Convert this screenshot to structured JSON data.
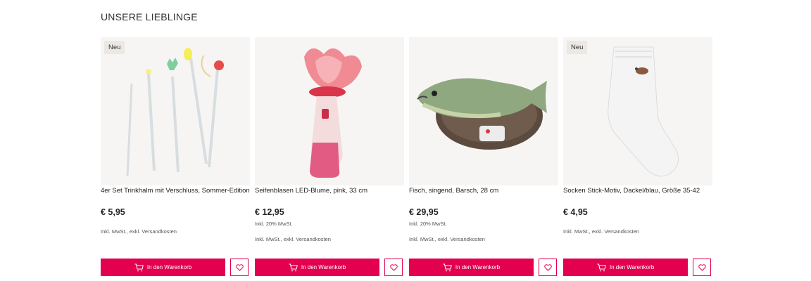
{
  "section": {
    "title": "UNSERE LIEBLINGE"
  },
  "products": [
    {
      "badge": "Neu",
      "name": "4er Set Trinkhalm mit Verschluss, Sommer-Edition",
      "price": "€ 5,95",
      "vat": "",
      "shipping": "Inkl. MwSt., exkl. Versandkosten",
      "cart_label": "In den Warenkorb",
      "image_icon": "straws-image"
    },
    {
      "badge": "",
      "name": "Seifenblasen LED-Blume, pink, 33 cm",
      "price": "€ 12,95",
      "vat": "Inkl. 20% MwSt.",
      "shipping": "Inkl. MwSt., exkl. Versandkosten",
      "cart_label": "In den Warenkorb",
      "image_icon": "bubble-flower-image"
    },
    {
      "badge": "",
      "name": "Fisch, singend, Barsch, 28 cm",
      "price": "€ 29,95",
      "vat": "Inkl. 20% MwSt.",
      "shipping": "Inkl. MwSt., exkl. Versandkosten",
      "cart_label": "In den Warenkorb",
      "image_icon": "singing-fish-image"
    },
    {
      "badge": "Neu",
      "name": "Socken Stick-Motiv, Dackel/blau, Größe 35-42",
      "price": "€ 4,95",
      "vat": "",
      "shipping": "Inkl. MwSt., exkl. Versandkosten",
      "cart_label": "In den Warenkorb",
      "image_icon": "sock-image"
    }
  ],
  "colors": {
    "accent": "#e2004f",
    "card_bg": "#f6f5f4",
    "badge_bg": "#ece9e4"
  }
}
